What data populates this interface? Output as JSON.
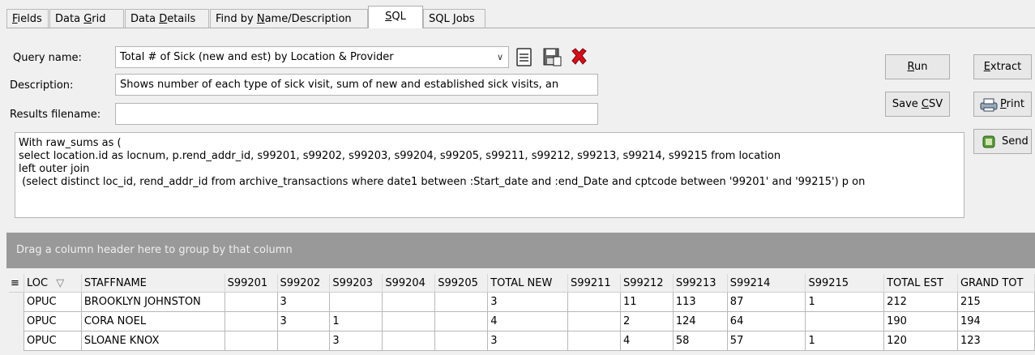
{
  "tabs": [
    {
      "pre": "",
      "u": "F",
      "post": "ields"
    },
    {
      "pre": "Data ",
      "u": "G",
      "post": "rid"
    },
    {
      "pre": "Data ",
      "u": "D",
      "post": "etails"
    },
    {
      "pre": "Find by ",
      "u": "N",
      "post": "ame/Description"
    },
    {
      "pre": "",
      "u": "S",
      "post": "QL"
    },
    {
      "pre": "SQL ",
      "u": "J",
      "post": "obs"
    }
  ],
  "query": {
    "name_label": "Query name:",
    "name_value": "Total # of Sick (new and est) by Location & Provider",
    "desc_label": "Description:",
    "desc_value": "Shows number of each type of sick visit, sum of new and established sick visits, an",
    "results_label": "Results filename:",
    "results_value": ""
  },
  "icons": [
    "save-icon",
    "save-as-icon",
    "delete-icon"
  ],
  "buttons": {
    "run": {
      "pre": "",
      "u": "R",
      "post": "un"
    },
    "extract": {
      "pre": "",
      "u": "E",
      "post": "xtract"
    },
    "save_csv": {
      "pre": "Save ",
      "u": "C",
      "post": "SV"
    },
    "print": {
      "pre": "",
      "u": "P",
      "post": "rint"
    },
    "send": "Send"
  },
  "sql_text": "With raw_sums as (\nselect location.id as locnum, p.rend_addr_id, s99201, s99202, s99203, s99204, s99205, s99211, s99212, s99213, s99214, s99215 from location\nleft outer join\n (select distinct loc_id, rend_addr_id from archive_transactions where date1 between :Start_date and :end_Date and cptcode between '99201' and '99215') p on",
  "group_hint": "Drag a column header here to group by that column",
  "grid": {
    "columns": [
      "LOC",
      "STAFFNAME",
      "S99201",
      "S99202",
      "S99203",
      "S99204",
      "S99205",
      "TOTAL NEW",
      "S99211",
      "S99212",
      "S99213",
      "S99214",
      "S99215",
      "TOTAL EST",
      "GRAND TOT"
    ],
    "rows": [
      [
        "OPUC",
        "BROOKLYN JOHNSTON",
        "",
        "3",
        "",
        "",
        "",
        "3",
        "",
        "11",
        "113",
        "87",
        "1",
        "212",
        "215"
      ],
      [
        "OPUC",
        "CORA NOEL",
        "",
        "3",
        "1",
        "",
        "",
        "4",
        "",
        "2",
        "124",
        "64",
        "",
        "190",
        "194"
      ],
      [
        "OPUC",
        "SLOANE KNOX",
        "",
        "",
        "3",
        "",
        "",
        "3",
        "",
        "4",
        "58",
        "57",
        "1",
        "120",
        "123"
      ]
    ]
  }
}
